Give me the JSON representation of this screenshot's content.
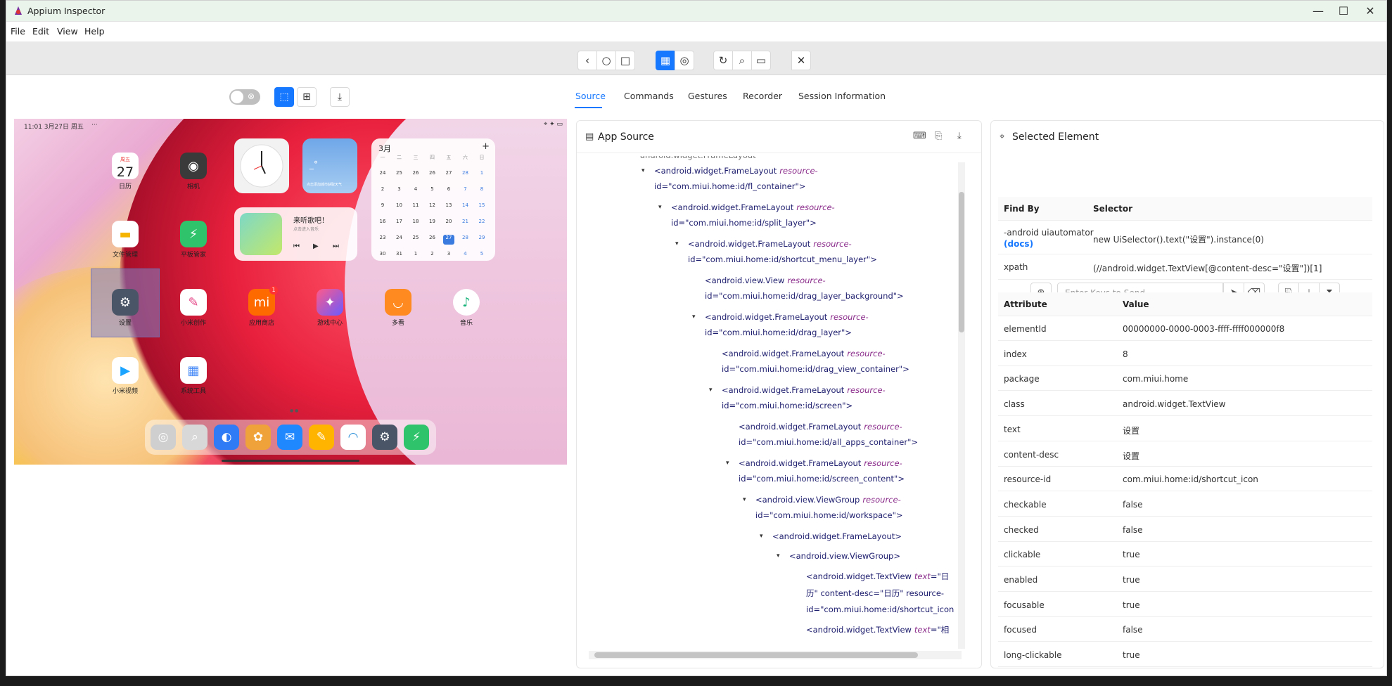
{
  "window": {
    "title": "Appium Inspector",
    "minimize": "—",
    "maximize": "☐",
    "close": "✕"
  },
  "menu": [
    "File",
    "Edit",
    "View",
    "Help"
  ],
  "toolbar": {
    "back": "‹",
    "home": "○",
    "square": "□",
    "grid": "▦",
    "globe": "◎",
    "refresh": "↻",
    "search": "⌕",
    "record": "▭",
    "quit": "✕"
  },
  "screenshot_controls": {
    "toggle_x": "⊗",
    "select": "⬚",
    "tap": "⊞",
    "download": "⤓"
  },
  "device": {
    "status_time": "11:01  3月27日 周五",
    "status_dots": "···",
    "status_icons": "⌖ ✦ ▭",
    "apps": [
      {
        "label": "日历",
        "glyph": "27",
        "sub": "周五"
      },
      {
        "label": "相机",
        "glyph": "◉"
      },
      {
        "label": "文件管理",
        "glyph": "▬"
      },
      {
        "label": "平板管家",
        "glyph": "⚡"
      },
      {
        "label": "设置",
        "glyph": "⚙"
      },
      {
        "label": "小米创作",
        "glyph": "✎"
      },
      {
        "label": "应用商店",
        "glyph": "mi",
        "badge": "1"
      },
      {
        "label": "游戏中心",
        "glyph": "✦"
      },
      {
        "label": "多看",
        "glyph": "◡"
      },
      {
        "label": "音乐",
        "glyph": "♪"
      },
      {
        "label": "小米视频",
        "glyph": "▶"
      },
      {
        "label": "系统工具",
        "glyph": "▦"
      }
    ],
    "calendar": {
      "month": "3月",
      "plus": "+",
      "weekdays": [
        "一",
        "二",
        "三",
        "四",
        "五",
        "六",
        "日"
      ],
      "rows": [
        [
          "24",
          "25",
          "26",
          "26",
          "27",
          "28",
          "1"
        ],
        [
          "2",
          "3",
          "4",
          "5",
          "6",
          "7",
          "8"
        ],
        [
          "9",
          "10",
          "11",
          "12",
          "13",
          "14",
          "15"
        ],
        [
          "16",
          "17",
          "18",
          "19",
          "20",
          "21",
          "22"
        ],
        [
          "23",
          "24",
          "25",
          "26",
          "27",
          "28",
          "29"
        ],
        [
          "30",
          "31",
          "1",
          "2",
          "3",
          "4",
          "5"
        ]
      ]
    },
    "music": {
      "title": "来听歌吧！",
      "sub": "点击进入音乐",
      "prev": "⏮",
      "play": "▶",
      "next": "⏭"
    },
    "weather": {
      "temp": "_°",
      "text": "点击添加城市获取天气"
    },
    "dock_icons": [
      "◎",
      "⌕",
      "◐",
      "✿",
      "✉",
      "✎",
      "◠",
      "⚙",
      "⚡"
    ]
  },
  "tabs": [
    "Source",
    "Commands",
    "Gestures",
    "Recorder",
    "Session Information"
  ],
  "source_panel": {
    "title": "App Source",
    "icon": "▤",
    "header_icons": {
      "terminal": "⌨",
      "copy": "⎘",
      "download": "⤓"
    },
    "lines": [
      {
        "caret": "",
        "text": "android.widget.FrameLayout"
      },
      {
        "caret": "▾",
        "tag": "<android.widget.FrameLayout",
        "attr": "resource-",
        "cont": "id=\"com.miui.home:id/fl_container\">"
      },
      {
        "caret": "▾",
        "tag": "<android.widget.FrameLayout",
        "attr": "resource-",
        "cont": "id=\"com.miui.home:id/split_layer\">"
      },
      {
        "caret": "▾",
        "tag": "<android.widget.FrameLayout",
        "attr": "resource-",
        "cont": "id=\"com.miui.home:id/shortcut_menu_layer\">"
      },
      {
        "caret": "",
        "tag": "<android.view.View",
        "attr": "resource-",
        "cont": "id=\"com.miui.home:id/drag_layer_background\">"
      },
      {
        "caret": "▾",
        "tag": "<android.widget.FrameLayout",
        "attr": "resource-",
        "cont": "id=\"com.miui.home:id/drag_layer\">"
      },
      {
        "caret": "",
        "tag": "<android.widget.FrameLayout",
        "attr": "resource-",
        "cont": "id=\"com.miui.home:id/drag_view_container\">"
      },
      {
        "caret": "▾",
        "tag": "<android.widget.FrameLayout",
        "attr": "resource-",
        "cont": "id=\"com.miui.home:id/screen\">"
      },
      {
        "caret": "",
        "tag": "<android.widget.FrameLayout",
        "attr": "resource-",
        "cont": "id=\"com.miui.home:id/all_apps_container\">"
      },
      {
        "caret": "▾",
        "tag": "<android.widget.FrameLayout",
        "attr": "resource-",
        "cont": "id=\"com.miui.home:id/screen_content\">"
      },
      {
        "caret": "▾",
        "tag": "<android.view.ViewGroup",
        "attr": "resource-",
        "cont": "id=\"com.miui.home:id/workspace\">"
      },
      {
        "caret": "▾",
        "tag": "<android.widget.FrameLayout>"
      },
      {
        "caret": "▾",
        "tag": "<android.view.ViewGroup>"
      },
      {
        "caret": "",
        "tag": "<android.widget.TextView",
        "attr": "text",
        "val": "=\"日",
        "cont": "历\" content-desc=\"日历\" resource-",
        "cont2": "id=\"com.miui.home:id/shortcut_icon"
      },
      {
        "caret": "",
        "tag": "<android.widget.TextView",
        "attr": "text",
        "val": "=\"相"
      }
    ]
  },
  "selected_panel": {
    "title": "Selected Element",
    "icon": "⌖",
    "keys_placeholder": "Enter Keys to Send",
    "buttons": {
      "tap": "⊕",
      "send": "➤",
      "clear": "⌫",
      "copy": "⎘",
      "download": "⤓",
      "timer": "⧗"
    },
    "find_headers": [
      "Find By",
      "Selector"
    ],
    "find_rows": [
      {
        "by": "-android uiautomator",
        "docs": "(docs)",
        "selector": "new UiSelector().text(\"设置\").instance(0)"
      },
      {
        "by": "xpath",
        "docs": "",
        "selector": "(//android.widget.TextView[@content-desc=\"设置\"])[1]"
      }
    ],
    "attr_headers": [
      "Attribute",
      "Value"
    ],
    "attributes": [
      {
        "name": "elementId",
        "value": "00000000-0000-0003-ffff-ffff000000f8"
      },
      {
        "name": "index",
        "value": "8"
      },
      {
        "name": "package",
        "value": "com.miui.home"
      },
      {
        "name": "class",
        "value": "android.widget.TextView"
      },
      {
        "name": "text",
        "value": "设置"
      },
      {
        "name": "content-desc",
        "value": "设置"
      },
      {
        "name": "resource-id",
        "value": "com.miui.home:id/shortcut_icon"
      },
      {
        "name": "checkable",
        "value": "false"
      },
      {
        "name": "checked",
        "value": "false"
      },
      {
        "name": "clickable",
        "value": "true"
      },
      {
        "name": "enabled",
        "value": "true"
      },
      {
        "name": "focusable",
        "value": "true"
      },
      {
        "name": "focused",
        "value": "false"
      },
      {
        "name": "long-clickable",
        "value": "true"
      }
    ]
  },
  "colors": {
    "accent": "#1677ff",
    "titlebar": "#eaf4ea",
    "toolbar": "#e9e9e9"
  }
}
